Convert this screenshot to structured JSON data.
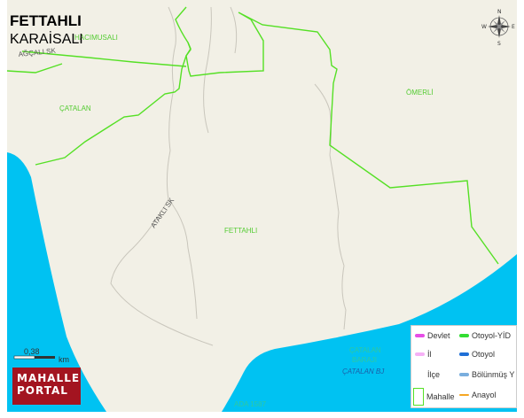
{
  "title": "FETTAHLI",
  "subtitle": "KARAİSALI",
  "labels": {
    "catalan": "ÇATALAN",
    "omerli": "ÖMERLİ",
    "fettahli": "FETTAHLI",
    "hacimusali": "HACIMUSALI",
    "agcali": "AĞÇALI SK",
    "atakli": "ATAKLI SK",
    "baraji": "ÇATALAN\nBARAJI",
    "catalan_bj": "ÇATALAN BJ",
    "ada": "ADA 1587"
  },
  "compass": {
    "n": "N",
    "s": "S",
    "e": "E",
    "w": "W"
  },
  "scale": {
    "value": "0,38",
    "unit": "km"
  },
  "logo": {
    "line1": "MAHALLE",
    "line2": "PORTAL"
  },
  "legend": {
    "items": [
      {
        "label": "Devlet",
        "color": "#e64ee6"
      },
      {
        "label": "Otoyol-YİD",
        "color": "#33dd33"
      },
      {
        "label": "İl",
        "color": "#f6b0f6"
      },
      {
        "label": "Otoyol",
        "color": "#1f6fd6"
      },
      {
        "label": "İlçe",
        "color": ""
      },
      {
        "label": "Bölünmüş Y",
        "color": "#7aaede"
      },
      {
        "label": "Mahalle",
        "color": ""
      },
      {
        "label": "Anayol",
        "color": "#f5a623"
      }
    ]
  },
  "colors": {
    "land": "#f2f0e6",
    "water": "#00c2f2",
    "boundary": "#55e025",
    "road": "#c9c6bc"
  }
}
